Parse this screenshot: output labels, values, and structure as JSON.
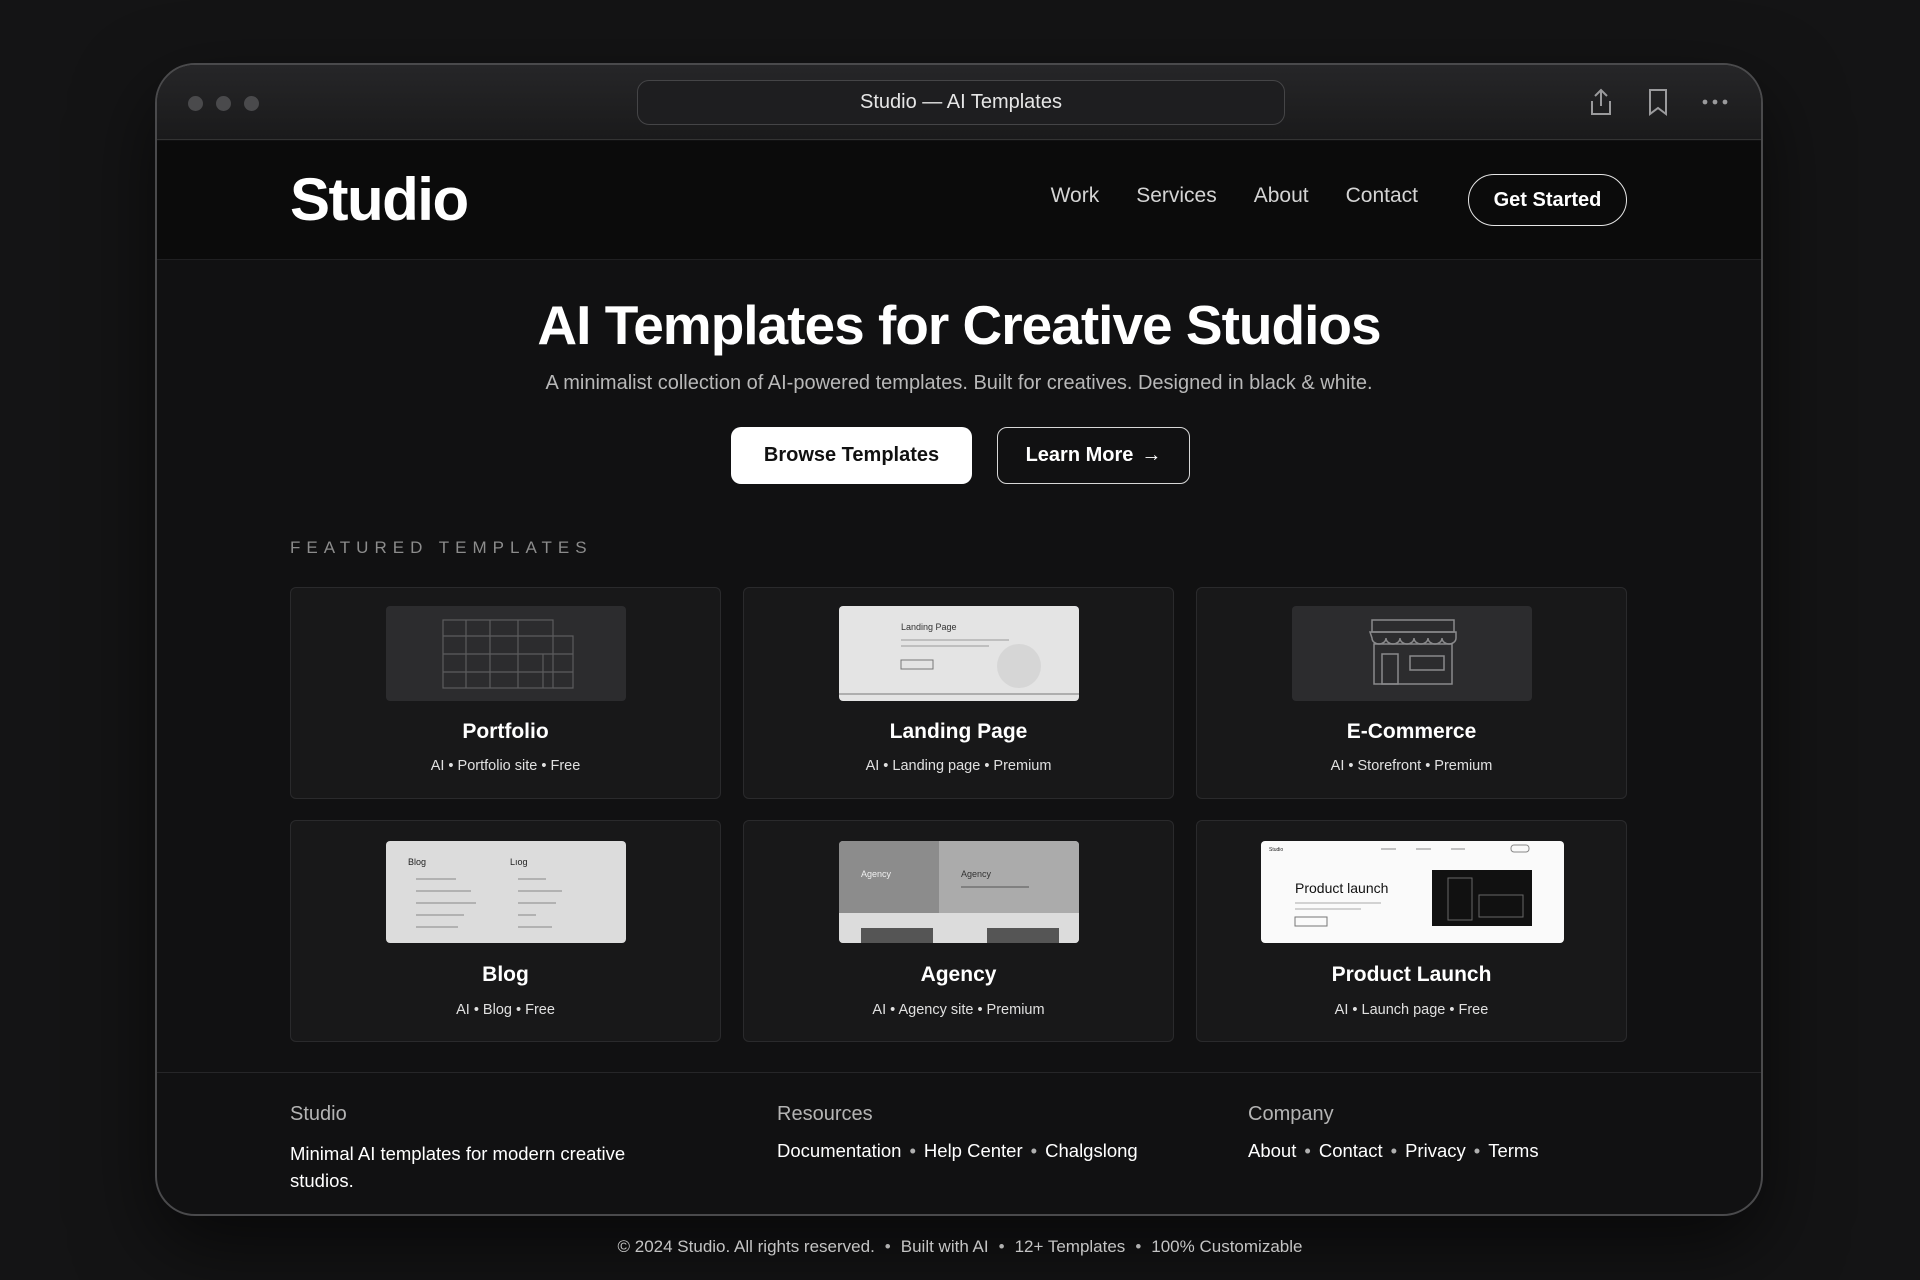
{
  "browser": {
    "title": "Studio — AI Templates",
    "traffic_lights": [
      "close",
      "minimize",
      "zoom"
    ],
    "icons": [
      "share-icon",
      "bookmark-icon",
      "more-icon"
    ]
  },
  "nav": {
    "logo": "Studio",
    "links": [
      "Work",
      "Services",
      "About",
      "Contact"
    ],
    "cta": "Get Started"
  },
  "hero": {
    "title": "AI Templates for Creative Studios",
    "subtitle": "A minimalist collection of AI-powered templates. Built for creatives. Designed in black & white.",
    "primary_button": "Browse Templates",
    "secondary_button": "Learn More",
    "secondary_icon": "→"
  },
  "featured": {
    "label": "FEATURED TEMPLATES",
    "cards": [
      {
        "title": "Portfolio",
        "meta": "AI • Portfolio site • Free",
        "thumb_text": ""
      },
      {
        "title": "Landing Page",
        "meta": "AI • Landing page • Premium",
        "thumb_text": "Landing Page"
      },
      {
        "title": "E-Commerce",
        "meta": "AI • Storefront • Premium",
        "thumb_text": ""
      },
      {
        "title": "Blog",
        "meta": "AI • Blog • Free",
        "thumb_text": "Blog"
      },
      {
        "title": "Agency",
        "meta": "AI • Agency site • Premium",
        "thumb_text": "Agency"
      },
      {
        "title": "Product Launch",
        "meta": "AI • Launch page • Free",
        "thumb_text": "Product launch"
      }
    ],
    "thumb_extra": {
      "blog_right": "Lıog",
      "agency_right": "Agency",
      "product_brand": "Studio"
    }
  },
  "footer": {
    "studio": {
      "heading": "Studio",
      "text": "Minimal AI templates for modern creative studios."
    },
    "resources": {
      "heading": "Resources",
      "links": [
        "Documentation",
        "Help Center",
        "Chalgslong"
      ]
    },
    "company": {
      "heading": "Company",
      "links": [
        "About",
        "Contact",
        "Privacy",
        "Terms"
      ]
    }
  },
  "bottom_bar": [
    "© 2024 Studio. All rights reserved.",
    "Built with AI",
    "12+ Templates",
    "100% Customizable"
  ],
  "separator": "•"
}
